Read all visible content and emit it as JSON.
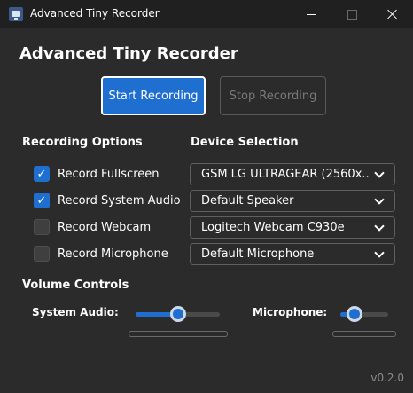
{
  "window": {
    "title": "Advanced Tiny Recorder",
    "controls": {
      "minimize": "minimize-icon",
      "maximize": "maximize-icon",
      "close": "close-icon"
    }
  },
  "app": {
    "title": "Advanced Tiny Recorder"
  },
  "buttons": {
    "start": "Start Recording",
    "stop": "Stop Recording"
  },
  "recording_options": {
    "heading": "Recording Options",
    "items": [
      {
        "label": "Record Fullscreen",
        "checked": true
      },
      {
        "label": "Record System Audio",
        "checked": true
      },
      {
        "label": "Record Webcam",
        "checked": false
      },
      {
        "label": "Record Microphone",
        "checked": false
      }
    ]
  },
  "device_selection": {
    "heading": "Device Selection",
    "selects": [
      {
        "value": "GSM LG ULTRAGEAR (2560x..."
      },
      {
        "value": "Default Speaker"
      },
      {
        "value": "Logitech Webcam C930e"
      },
      {
        "value": "Default Microphone"
      }
    ]
  },
  "volume": {
    "heading": "Volume Controls",
    "system_audio": {
      "label": "System Audio:",
      "level": 0.5
    },
    "microphone": {
      "label": "Microphone:",
      "level": 0.3
    }
  },
  "version": "v0.2.0",
  "colors": {
    "accent": "#1f6fd1",
    "background": "#2b2b2b",
    "titlebar": "#202020"
  },
  "icons": {
    "checkmark": "checkmark-icon",
    "chevron": "chevron-down-icon"
  }
}
